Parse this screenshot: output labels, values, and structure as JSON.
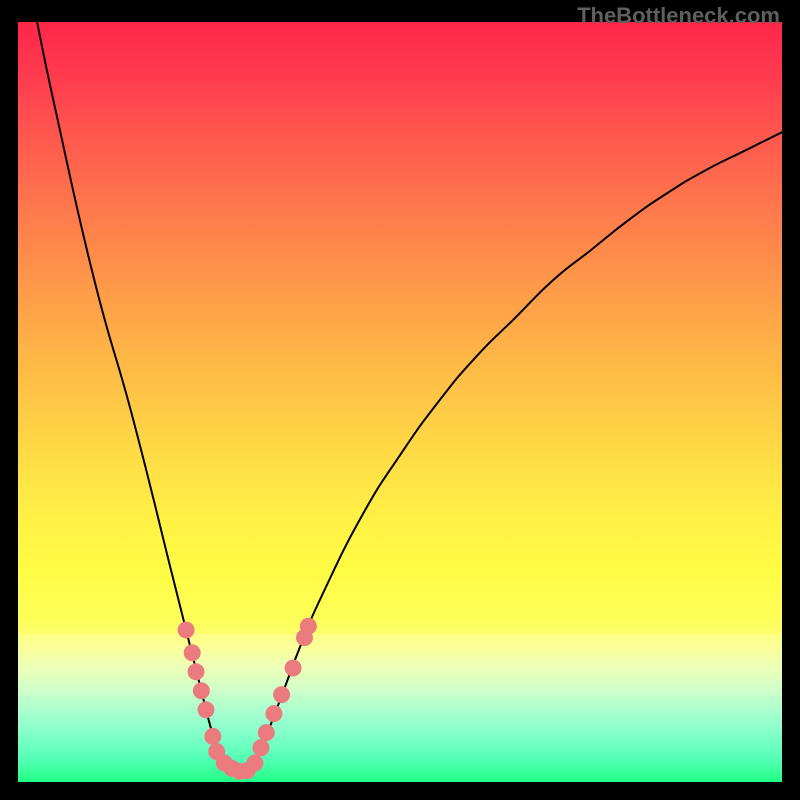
{
  "watermark": "TheBottleneck.com",
  "chart_data": {
    "type": "line",
    "title": "",
    "xlabel": "",
    "ylabel": "",
    "xlim": [
      0,
      100
    ],
    "ylim": [
      0,
      100
    ],
    "curve_left": {
      "name": "left-branch",
      "points": [
        {
          "x": 2.5,
          "y": 100
        },
        {
          "x": 5,
          "y": 88
        },
        {
          "x": 10,
          "y": 66
        },
        {
          "x": 15,
          "y": 48
        },
        {
          "x": 20,
          "y": 28
        },
        {
          "x": 22,
          "y": 20
        },
        {
          "x": 24,
          "y": 12
        },
        {
          "x": 25,
          "y": 8
        },
        {
          "x": 26.5,
          "y": 3
        },
        {
          "x": 28,
          "y": 1.5
        },
        {
          "x": 29.5,
          "y": 1.2
        }
      ]
    },
    "curve_right": {
      "name": "right-branch",
      "points": [
        {
          "x": 29.5,
          "y": 1.2
        },
        {
          "x": 31,
          "y": 2.5
        },
        {
          "x": 34,
          "y": 10
        },
        {
          "x": 37,
          "y": 18
        },
        {
          "x": 40,
          "y": 25
        },
        {
          "x": 45,
          "y": 35
        },
        {
          "x": 50,
          "y": 43
        },
        {
          "x": 55,
          "y": 50
        },
        {
          "x": 60,
          "y": 56
        },
        {
          "x": 65,
          "y": 61
        },
        {
          "x": 70,
          "y": 66
        },
        {
          "x": 75,
          "y": 70
        },
        {
          "x": 80,
          "y": 74
        },
        {
          "x": 85,
          "y": 77.5
        },
        {
          "x": 90,
          "y": 80.5
        },
        {
          "x": 95,
          "y": 83
        },
        {
          "x": 100,
          "y": 85.5
        }
      ]
    },
    "markers_left": [
      {
        "x": 22,
        "y": 20
      },
      {
        "x": 22.8,
        "y": 17
      },
      {
        "x": 23.3,
        "y": 14.5
      },
      {
        "x": 24,
        "y": 12
      },
      {
        "x": 24.6,
        "y": 9.5
      },
      {
        "x": 25.5,
        "y": 6
      },
      {
        "x": 26,
        "y": 4
      },
      {
        "x": 27,
        "y": 2.5
      },
      {
        "x": 28,
        "y": 1.8
      },
      {
        "x": 29,
        "y": 1.4
      },
      {
        "x": 30,
        "y": 1.5
      }
    ],
    "markers_right": [
      {
        "x": 31,
        "y": 2.5
      },
      {
        "x": 31.8,
        "y": 4.5
      },
      {
        "x": 32.5,
        "y": 6.5
      },
      {
        "x": 33.5,
        "y": 9
      },
      {
        "x": 34.5,
        "y": 11.5
      },
      {
        "x": 36,
        "y": 15
      },
      {
        "x": 37.5,
        "y": 19
      },
      {
        "x": 38,
        "y": 20.5
      }
    ],
    "gradient_colors": {
      "top": "#ff2649",
      "mid": "#fffc45",
      "bottom": "#1dff85"
    }
  }
}
